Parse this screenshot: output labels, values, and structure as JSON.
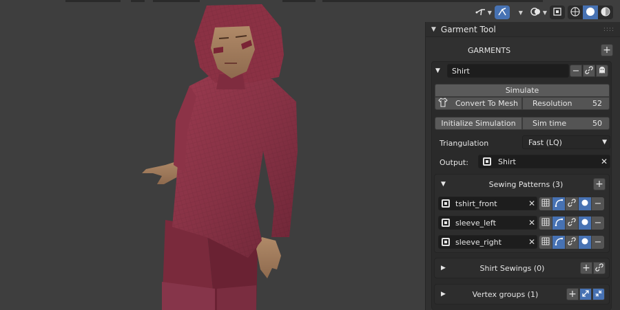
{
  "viewport": {
    "icons": [
      "gizmo-icon",
      "gizmo-toggle-icon",
      "overlay-icon",
      "xray-icon",
      "wireframe-shading-icon",
      "solid-shading-icon",
      "material-shading-icon"
    ]
  },
  "panel": {
    "title": "Garment Tool",
    "garments_label": "GARMENTS",
    "garment_name": "Shirt",
    "simulate_label": "Simulate",
    "convert_label": "Convert To Mesh",
    "resolution_label": "Resolution",
    "resolution_value": "52",
    "init_sim_label": "Initialize Simulation",
    "sim_time_label": "Sim time",
    "sim_time_value": "50",
    "triangulation_label": "Triangulation",
    "triangulation_value": "Fast (LQ)",
    "output_label": "Output:",
    "output_value": "Shirt",
    "sewing_patterns_label": "Sewing Patterns (3)",
    "patterns": [
      {
        "name": "tshirt_front"
      },
      {
        "name": "sleeve_left"
      },
      {
        "name": "sleeve_right"
      }
    ],
    "shirt_sewings_label": "Shirt Sewings (0)",
    "vertex_groups_label": "Vertex groups (1)"
  }
}
